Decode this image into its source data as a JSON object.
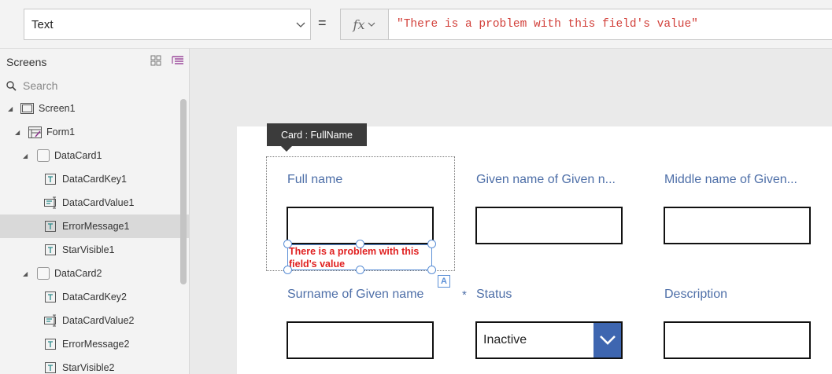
{
  "formula_bar": {
    "property": "Text",
    "equals": "=",
    "fx_label": "fx",
    "formula": "\"There is a problem with this field's value\""
  },
  "tree_panel": {
    "title": "Screens",
    "search_placeholder": "Search",
    "items": [
      {
        "label": "Screen1",
        "icon": "screen-icon",
        "selected": false
      },
      {
        "label": "Form1",
        "icon": "form-icon",
        "selected": false
      },
      {
        "label": "DataCard1",
        "icon": "card-icon",
        "selected": false
      },
      {
        "label": "DataCardKey1",
        "icon": "label-icon",
        "selected": false
      },
      {
        "label": "DataCardValue1",
        "icon": "textinput-icon",
        "selected": false
      },
      {
        "label": "ErrorMessage1",
        "icon": "label-icon",
        "selected": true
      },
      {
        "label": "StarVisible1",
        "icon": "label-icon",
        "selected": false
      },
      {
        "label": "DataCard2",
        "icon": "card-icon",
        "selected": false
      },
      {
        "label": "DataCardKey2",
        "icon": "label-icon",
        "selected": false
      },
      {
        "label": "DataCardValue2",
        "icon": "textinput-icon",
        "selected": false
      },
      {
        "label": "ErrorMessage2",
        "icon": "label-icon",
        "selected": false
      },
      {
        "label": "StarVisible2",
        "icon": "label-icon",
        "selected": false
      }
    ]
  },
  "canvas": {
    "tooltip": "Card : FullName",
    "fields": [
      {
        "label": "Full name"
      },
      {
        "label": "Given name of Given n..."
      },
      {
        "label": "Middle name of Given..."
      },
      {
        "label": "Surname of Given name"
      },
      {
        "label": "Status"
      },
      {
        "label": "Description"
      }
    ],
    "error_message": "There is a problem with this field's value",
    "required_marker": "*",
    "status_value": "Inactive",
    "autosize_badge": "A"
  },
  "colors": {
    "accent": "#3e66b0",
    "label": "#4e6fa8",
    "error": "#e02020",
    "formula_text": "#d2403a"
  }
}
